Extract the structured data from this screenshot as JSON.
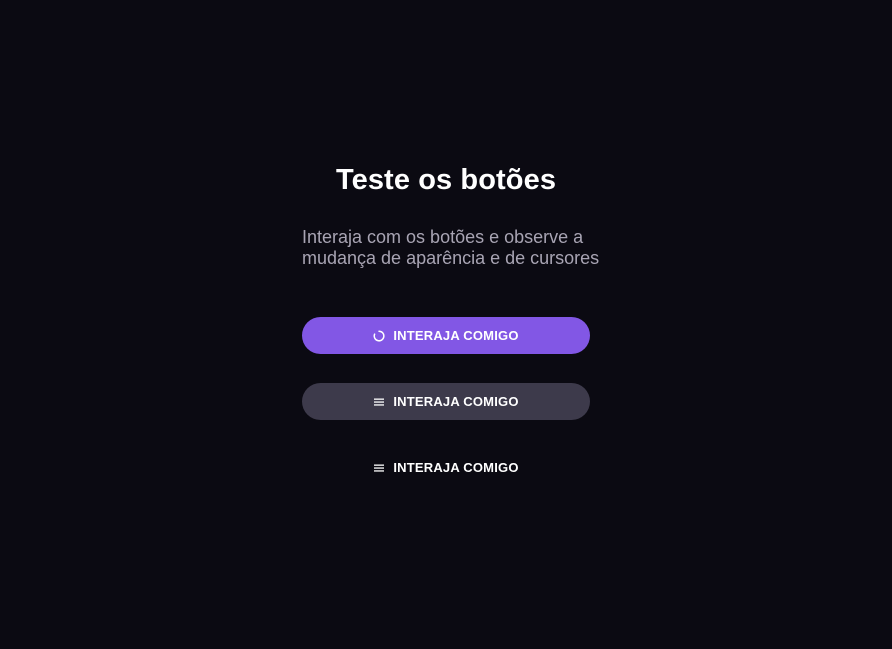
{
  "page": {
    "title": "Teste os botões",
    "subtitle": "Interaja com os botões e observe a mudança de aparência e de cursores"
  },
  "buttons": [
    {
      "label": "INTERAJA COMIGO",
      "icon": "spinner-icon"
    },
    {
      "label": "INTERAJA COMIGO",
      "icon": "list-icon"
    },
    {
      "label": "INTERAJA COMIGO",
      "icon": "list-icon"
    }
  ],
  "colors": {
    "background": "#0b0a12",
    "primary": "#8257e5",
    "secondary": "#3d3a4b",
    "text": "#ffffff",
    "muted": "#a8a4b3"
  }
}
